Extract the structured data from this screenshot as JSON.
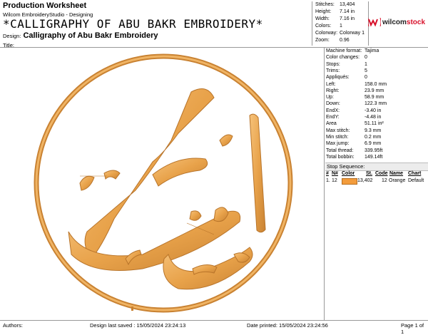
{
  "header": {
    "title": "Production Worksheet",
    "subtitle": "Wilcom EmbroideryStudio - Designing",
    "design_name_big": "*CALLIGRAPHY OF ABU BAKR EMBROIDERY*",
    "design_label": "Design:",
    "design_name": "Calligraphy of Abu Bakr Embroidery",
    "title_label": "Title:"
  },
  "stats": [
    {
      "label": "Stitches:",
      "value": "13,404"
    },
    {
      "label": "Height:",
      "value": "7.14 in"
    },
    {
      "label": "Width:",
      "value": "7.16 in"
    },
    {
      "label": "Colors:",
      "value": "1"
    },
    {
      "label": "Colorway:",
      "value": "Colorway 1"
    },
    {
      "label": "Zoom:",
      "value": "0.96"
    }
  ],
  "logo": {
    "brand": "wilcom",
    "suffix": "stock",
    "color": "#d8112b"
  },
  "info": [
    {
      "label": "Machine format:",
      "value": "Tajima"
    },
    {
      "label": "Color changes:",
      "value": "0"
    },
    {
      "label": "Stops:",
      "value": "1"
    },
    {
      "label": "Trims:",
      "value": "5"
    },
    {
      "label": "Appliqués:",
      "value": "0"
    },
    {
      "label": "Left:",
      "value": "158.0 mm"
    },
    {
      "label": "Right:",
      "value": "23.9 mm"
    },
    {
      "label": "Up:",
      "value": "58.9 mm"
    },
    {
      "label": "Down:",
      "value": "122.3 mm"
    },
    {
      "label": "EndX:",
      "value": "-3.40 in"
    },
    {
      "label": "EndY:",
      "value": "-4.48 in"
    },
    {
      "label": "Area",
      "value": "51.11 in²"
    },
    {
      "label": "Max stitch:",
      "value": "9.3 mm"
    },
    {
      "label": "Min stitch:",
      "value": "0.2 mm"
    },
    {
      "label": "Max jump:",
      "value": "6.9 mm"
    },
    {
      "label": "Total thread:",
      "value": "339.95ft"
    },
    {
      "label": "Total bobbin:",
      "value": "149.14ft"
    }
  ],
  "stop_sequence": {
    "title": "Stop Sequence:",
    "columns": [
      "#",
      "N#",
      "Color",
      "St.",
      "Code",
      "Name",
      "Chart"
    ],
    "rows": [
      {
        "num": "1.",
        "n": "12",
        "stitches": "13,402",
        "code": "12",
        "name": "Orange",
        "chart": "Default",
        "color": "#f39c3c"
      }
    ]
  },
  "footer": {
    "authors": "Authors:",
    "saved": "Design last saved : 15/05/2024 23:24:13",
    "printed": "Date printed: 15/05/2024 23:24:56",
    "page": "Page 1 of 1"
  },
  "embroidery": {
    "thread_color": "#e8a24a",
    "shadow_color": "#b8742a"
  }
}
